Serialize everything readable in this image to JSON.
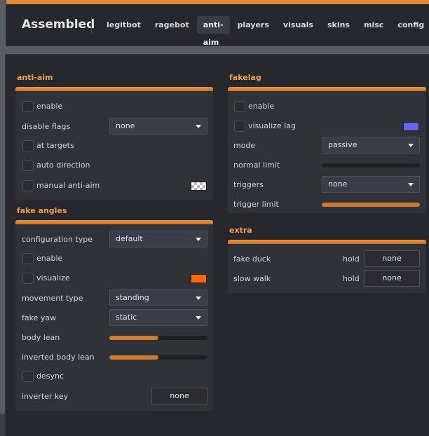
{
  "app": {
    "title": "Assembled"
  },
  "tabs": [
    "legitbot",
    "ragebot",
    "anti-aim",
    "players",
    "visuals",
    "skins",
    "misc",
    "config"
  ],
  "active_tab": "anti-aim",
  "colors": {
    "accent": "#e08a38",
    "visualize_lag": "#6666ee",
    "visualize_fake": "#ff6a00"
  },
  "antiaim": {
    "title": "anti-aim",
    "enable": "enable",
    "disable_flags": {
      "label": "disable flags",
      "value": "none"
    },
    "at_targets": "at targets",
    "auto_direction": "auto direction",
    "manual": "manual anti-aim"
  },
  "fake_angles": {
    "title": "fake angles",
    "config_type": {
      "label": "configuration type",
      "value": "default"
    },
    "enable": "enable",
    "visualize": "visualize",
    "movement_type": {
      "label": "movement type",
      "value": "standing"
    },
    "fake_yaw": {
      "label": "fake yaw",
      "value": "static"
    },
    "body_lean": {
      "label": "body lean",
      "level": 0.5
    },
    "inverted_body_lean": {
      "label": "inverted body lean",
      "level": 0.5
    },
    "desync": "desync",
    "inverter_key": {
      "label": "inverter key",
      "value": "none"
    }
  },
  "fakelag": {
    "title": "fakelag",
    "enable": "enable",
    "visualize_lag": "visualize lag",
    "mode": {
      "label": "mode",
      "value": "passive"
    },
    "normal_limit": {
      "label": "normal limit",
      "level": 0.0
    },
    "triggers": {
      "label": "triggers",
      "value": "none"
    },
    "trigger_limit": {
      "label": "trigger limit",
      "level": 1.0
    }
  },
  "extra": {
    "title": "extra",
    "fake_duck": {
      "label": "fake duck",
      "mode": "hold",
      "key": "none"
    },
    "slow_walk": {
      "label": "slow walk",
      "mode": "hold",
      "key": "none"
    }
  }
}
